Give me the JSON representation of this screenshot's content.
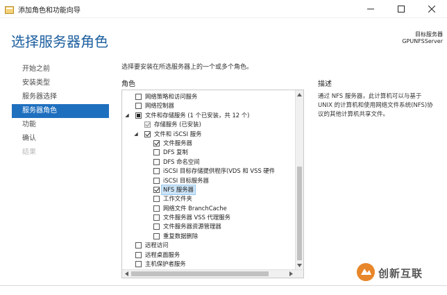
{
  "window": {
    "title": "添加角色和功能向导",
    "icon": "wizard-app-icon",
    "controls": [
      "minimize-icon",
      "maximize-icon",
      "close-icon"
    ]
  },
  "header": {
    "title": "选择服务器角色",
    "destination_label": "目标服务器",
    "destination_server": "GPUNFSServer"
  },
  "nav": {
    "items": [
      {
        "label": "开始之前",
        "state": "normal"
      },
      {
        "label": "安装类型",
        "state": "normal"
      },
      {
        "label": "服务器选择",
        "state": "normal"
      },
      {
        "label": "服务器角色",
        "state": "active"
      },
      {
        "label": "功能",
        "state": "normal"
      },
      {
        "label": "确认",
        "state": "normal"
      },
      {
        "label": "结果",
        "state": "disabled"
      }
    ]
  },
  "main": {
    "instruction": "选择要安装在所选服务器上的一个或多个角色。",
    "roles_heading": "角色",
    "description_heading": "描述",
    "description_text": "通过 NFS 服务器，此计算机可以与基于 UNIX 的计算机和使用网络文件系统(NFS)协议的其他计算机共享文件。"
  },
  "roles": [
    {
      "label": "网络策略和访问服务",
      "level": 0,
      "check": "none",
      "expander": ""
    },
    {
      "label": "网络控制器",
      "level": 0,
      "check": "none",
      "expander": ""
    },
    {
      "label": "文件和存储服务 (1 个已安装，共 12 个)",
      "level": 0,
      "check": "partial",
      "expander": "◢"
    },
    {
      "label": "存储服务 (已安装)",
      "level": 1,
      "check": "greyed",
      "expander": ""
    },
    {
      "label": "文件和 iSCSI 服务",
      "level": 1,
      "check": "checked",
      "expander": "◢"
    },
    {
      "label": "文件服务器",
      "level": 2,
      "check": "checked",
      "expander": ""
    },
    {
      "label": "DFS 复制",
      "level": 2,
      "check": "none",
      "expander": ""
    },
    {
      "label": "DFS 命名空间",
      "level": 2,
      "check": "none",
      "expander": ""
    },
    {
      "label": "iSCSI 目标存储提供程序(VDS 和 VSS 硬件",
      "level": 2,
      "check": "none",
      "expander": ""
    },
    {
      "label": "iSCSI 目标服务器",
      "level": 2,
      "check": "none",
      "expander": ""
    },
    {
      "label": "NFS 服务器",
      "level": 2,
      "check": "checked",
      "expander": "",
      "selected": true
    },
    {
      "label": "工作文件夹",
      "level": 2,
      "check": "none",
      "expander": ""
    },
    {
      "label": "网络文件 BranchCache",
      "level": 2,
      "check": "none",
      "expander": ""
    },
    {
      "label": "文件服务器 VSS 代理服务",
      "level": 2,
      "check": "none",
      "expander": ""
    },
    {
      "label": "文件服务器资源管理器",
      "level": 2,
      "check": "none",
      "expander": ""
    },
    {
      "label": "重复数据删除",
      "level": 2,
      "check": "none",
      "expander": ""
    },
    {
      "label": "远程访问",
      "level": 0,
      "check": "none",
      "expander": ""
    },
    {
      "label": "远程桌面服务",
      "level": 0,
      "check": "none",
      "expander": ""
    },
    {
      "label": "主机保护者服务",
      "level": 0,
      "check": "none",
      "expander": ""
    }
  ],
  "watermark": {
    "text": "创新互联",
    "logo": "watermark-logo-icon"
  },
  "colors": {
    "title_blue": "#1b5e9e",
    "nav_active_bg": "#1f6fbf",
    "selection_bg": "#cce4f7"
  }
}
